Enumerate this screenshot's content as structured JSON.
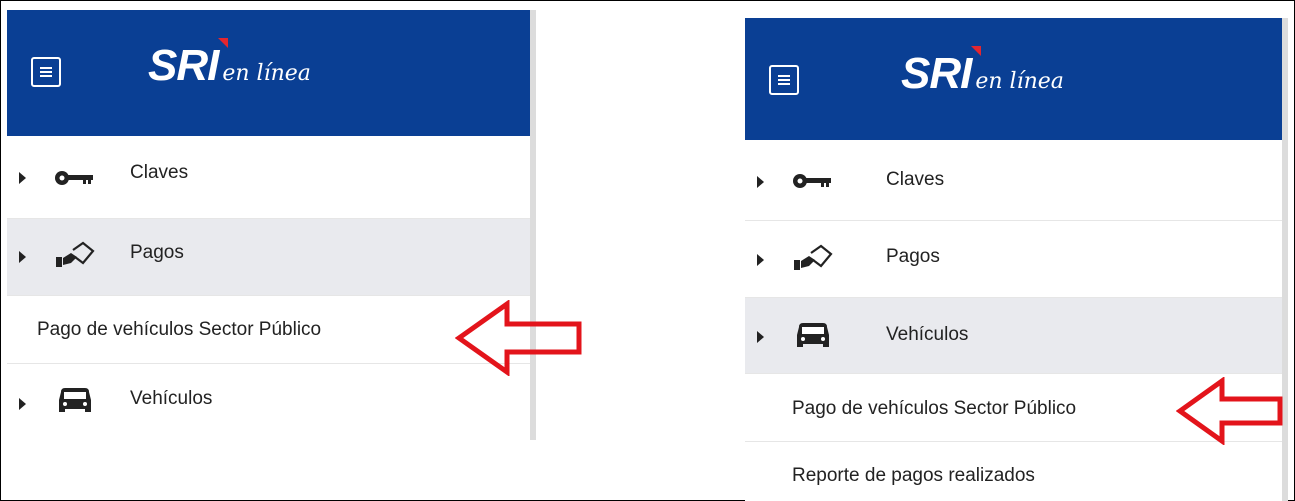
{
  "brand": {
    "name": "SRI",
    "tagline": "en línea"
  },
  "left_panel": {
    "items": [
      {
        "label": "Claves"
      },
      {
        "label": "Pagos"
      },
      {
        "label": "Pago de vehículos Sector Público"
      },
      {
        "label": "Vehículos"
      }
    ]
  },
  "right_panel": {
    "items": [
      {
        "label": "Claves"
      },
      {
        "label": "Pagos"
      },
      {
        "label": "Vehículos"
      },
      {
        "label": "Pago de vehículos Sector Público"
      },
      {
        "label": "Reporte de pagos realizados"
      }
    ]
  },
  "colors": {
    "header": "#0a3f94",
    "arrow": "#e3141b",
    "active_row": "#e9eaee"
  }
}
